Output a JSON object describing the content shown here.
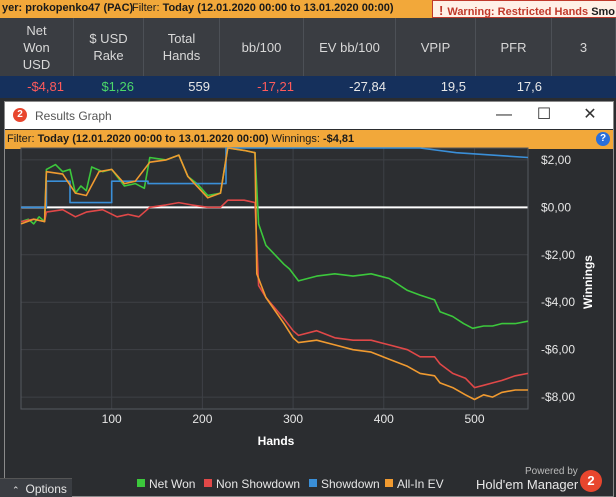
{
  "top_bar": {
    "player_text": "yer: prokopenko47 (PAC)",
    "filter_label": "Filter:",
    "filter_value": "Today (12.01.2020 00:00 to 13.01.2020 00:00)",
    "warning_icon": "!",
    "warning_text": "Warning: Restricted Hands",
    "warning_more": "Smo"
  },
  "stats": {
    "columns": [
      "Net\nWon\nUSD",
      "$ USD\nRake",
      "Total\nHands",
      "bb/100",
      "EV bb/100",
      "VPIP",
      "PFR",
      "3"
    ],
    "values": [
      "-$4,81",
      "$1,26",
      "559",
      "-17,21",
      "-27,84",
      "19,5",
      "17,6",
      ""
    ]
  },
  "window": {
    "logo_glyph": "2",
    "title": "Results Graph",
    "minimize_glyph": "—",
    "maximize_glyph": "☐",
    "close_glyph": "✕",
    "filter_label": "Filter:",
    "filter_value": "Today (12.01.2020 00:00 to 13.01.2020 00:00)",
    "winnings_label": "Winnings:",
    "winnings_value": "-$4,81",
    "help_glyph": "?"
  },
  "chart_data": {
    "type": "line",
    "xlabel": "Hands",
    "ylabel": "Winnings",
    "xlim": [
      0,
      559
    ],
    "ylim": [
      -8.5,
      2.5
    ],
    "x_ticks": [
      100,
      200,
      300,
      400,
      500
    ],
    "y_ticks": [
      {
        "value": 2,
        "label": "$2,00"
      },
      {
        "value": 0,
        "label": "$0,00"
      },
      {
        "value": -2,
        "label": "-$2,00"
      },
      {
        "value": -4,
        "label": "-$4,00"
      },
      {
        "value": -6,
        "label": "-$6,00"
      },
      {
        "value": -8,
        "label": "-$8,00"
      }
    ],
    "grid": true,
    "legend_position": "bottom",
    "series": [
      {
        "name": "Net Won",
        "color": "#3cc83c",
        "points": [
          [
            0,
            -0.6
          ],
          [
            8,
            -0.5
          ],
          [
            14,
            -0.7
          ],
          [
            20,
            -0.4
          ],
          [
            26,
            -0.6
          ],
          [
            28,
            1.6
          ],
          [
            38,
            1.8
          ],
          [
            46,
            1.5
          ],
          [
            54,
            1.6
          ],
          [
            60,
            0.6
          ],
          [
            66,
            0.9
          ],
          [
            72,
            0.7
          ],
          [
            78,
            1.7
          ],
          [
            90,
            1.5
          ],
          [
            100,
            1.6
          ],
          [
            114,
            0.9
          ],
          [
            126,
            1.0
          ],
          [
            136,
            0.8
          ],
          [
            142,
            2.1
          ],
          [
            160,
            2.0
          ],
          [
            174,
            2.2
          ],
          [
            184,
            1.3
          ],
          [
            194,
            1.0
          ],
          [
            206,
            0.5
          ],
          [
            220,
            0.6
          ],
          [
            228,
            2.5
          ],
          [
            246,
            2.4
          ],
          [
            258,
            2.3
          ],
          [
            262,
            -0.7
          ],
          [
            270,
            -1.6
          ],
          [
            290,
            -2.4
          ],
          [
            296,
            -2.6
          ],
          [
            306,
            -3.1
          ],
          [
            326,
            -2.9
          ],
          [
            346,
            -2.8
          ],
          [
            366,
            -2.9
          ],
          [
            386,
            -2.8
          ],
          [
            406,
            -3.0
          ],
          [
            426,
            -3.5
          ],
          [
            440,
            -3.7
          ],
          [
            456,
            -3.9
          ],
          [
            462,
            -4.4
          ],
          [
            476,
            -4.6
          ],
          [
            488,
            -4.9
          ],
          [
            498,
            -5.1
          ],
          [
            510,
            -5.0
          ],
          [
            520,
            -5.0
          ],
          [
            530,
            -4.9
          ],
          [
            545,
            -4.9
          ],
          [
            559,
            -4.8
          ]
        ]
      },
      {
        "name": "Non Showdown",
        "color": "#e04848",
        "points": [
          [
            0,
            -0.6
          ],
          [
            14,
            -0.5
          ],
          [
            26,
            -0.6
          ],
          [
            28,
            -0.2
          ],
          [
            46,
            -0.1
          ],
          [
            60,
            -0.4
          ],
          [
            72,
            -0.2
          ],
          [
            90,
            -0.1
          ],
          [
            106,
            -0.4
          ],
          [
            118,
            -0.3
          ],
          [
            130,
            -0.4
          ],
          [
            142,
            0.0
          ],
          [
            160,
            0.1
          ],
          [
            174,
            0.2
          ],
          [
            188,
            0.1
          ],
          [
            206,
            0.0
          ],
          [
            220,
            0.0
          ],
          [
            228,
            0.3
          ],
          [
            246,
            0.3
          ],
          [
            258,
            0.2
          ],
          [
            262,
            -3.3
          ],
          [
            270,
            -3.8
          ],
          [
            290,
            -4.7
          ],
          [
            300,
            -5.2
          ],
          [
            306,
            -5.4
          ],
          [
            326,
            -5.2
          ],
          [
            346,
            -5.5
          ],
          [
            366,
            -5.6
          ],
          [
            386,
            -5.6
          ],
          [
            406,
            -5.8
          ],
          [
            426,
            -6.0
          ],
          [
            440,
            -6.3
          ],
          [
            456,
            -6.3
          ],
          [
            462,
            -6.6
          ],
          [
            476,
            -7.0
          ],
          [
            490,
            -7.2
          ],
          [
            500,
            -7.6
          ],
          [
            510,
            -7.5
          ],
          [
            520,
            -7.4
          ],
          [
            530,
            -7.3
          ],
          [
            545,
            -7.1
          ],
          [
            559,
            -7.0
          ]
        ]
      },
      {
        "name": "Showdown",
        "color": "#3a8fd8",
        "points": [
          [
            0,
            0.0
          ],
          [
            28,
            0.0
          ],
          [
            28,
            1.1
          ],
          [
            54,
            1.1
          ],
          [
            54,
            0.2
          ],
          [
            100,
            0.2
          ],
          [
            100,
            1.1
          ],
          [
            140,
            1.1
          ],
          [
            140,
            1.0
          ],
          [
            200,
            1.0
          ],
          [
            226,
            1.0
          ],
          [
            226,
            2.5
          ],
          [
            440,
            2.5
          ],
          [
            480,
            2.3
          ],
          [
            559,
            2.1
          ]
        ]
      },
      {
        "name": "All-In EV",
        "color": "#f09a30",
        "points": [
          [
            0,
            -0.7
          ],
          [
            14,
            -0.5
          ],
          [
            26,
            -0.6
          ],
          [
            28,
            1.5
          ],
          [
            46,
            1.4
          ],
          [
            60,
            0.6
          ],
          [
            72,
            0.5
          ],
          [
            86,
            1.5
          ],
          [
            100,
            1.6
          ],
          [
            114,
            1.0
          ],
          [
            126,
            1.1
          ],
          [
            142,
            1.9
          ],
          [
            160,
            2.0
          ],
          [
            174,
            2.2
          ],
          [
            184,
            1.3
          ],
          [
            206,
            0.4
          ],
          [
            220,
            0.6
          ],
          [
            228,
            2.5
          ],
          [
            246,
            2.4
          ],
          [
            258,
            2.3
          ],
          [
            260,
            -2.8
          ],
          [
            270,
            -3.8
          ],
          [
            290,
            -4.9
          ],
          [
            300,
            -5.5
          ],
          [
            306,
            -5.7
          ],
          [
            326,
            -5.6
          ],
          [
            346,
            -5.8
          ],
          [
            366,
            -6.0
          ],
          [
            386,
            -6.1
          ],
          [
            406,
            -6.4
          ],
          [
            426,
            -6.7
          ],
          [
            440,
            -7.0
          ],
          [
            456,
            -7.1
          ],
          [
            462,
            -7.4
          ],
          [
            476,
            -7.6
          ],
          [
            490,
            -7.9
          ],
          [
            500,
            -8.1
          ],
          [
            510,
            -7.9
          ],
          [
            520,
            -8.0
          ],
          [
            530,
            -7.8
          ],
          [
            545,
            -7.7
          ],
          [
            559,
            -7.7
          ]
        ]
      }
    ]
  },
  "branding": {
    "powered_by": "Powered by",
    "name": "Hold'em Manager",
    "logo_glyph": "2"
  },
  "options": {
    "caret": "⌃",
    "label": "Options"
  }
}
